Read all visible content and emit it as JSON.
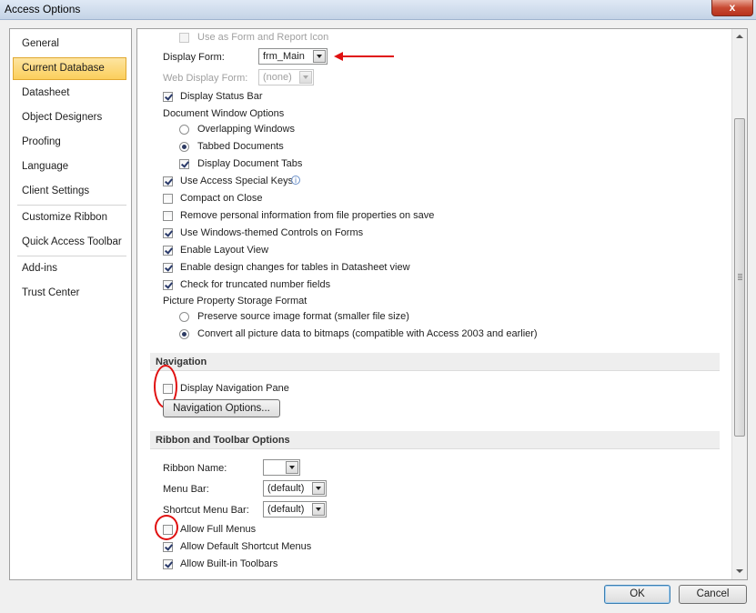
{
  "window": {
    "title": "Access Options",
    "close_label": "x"
  },
  "sidebar": {
    "items": [
      {
        "label": "General"
      },
      {
        "label": "Current Database"
      },
      {
        "label": "Datasheet"
      },
      {
        "label": "Object Designers"
      },
      {
        "label": "Proofing"
      },
      {
        "label": "Language"
      },
      {
        "label": "Client Settings"
      },
      {
        "label": "Customize Ribbon"
      },
      {
        "label": "Quick Access Toolbar"
      },
      {
        "label": "Add-ins"
      },
      {
        "label": "Trust Center"
      }
    ],
    "selected": "Current Database"
  },
  "app_options": {
    "use_as_form_report_icon": {
      "label": "Use as Form and Report Icon",
      "checked": false,
      "enabled": false
    },
    "display_form": {
      "label": "Display Form:",
      "value": "frm_Main"
    },
    "web_display_form": {
      "label": "Web Display Form:",
      "value": "(none)",
      "enabled": false
    },
    "display_status_bar": {
      "label": "Display Status Bar",
      "checked": true
    },
    "document_window_options": {
      "label": "Document Window Options",
      "overlapping_windows": {
        "label": "Overlapping Windows",
        "selected": false
      },
      "tabbed_documents": {
        "label": "Tabbed Documents",
        "selected": true
      },
      "display_document_tabs": {
        "label": "Display Document Tabs",
        "checked": true
      }
    },
    "use_access_special_keys": {
      "label": "Use Access Special Keys",
      "checked": true,
      "info_icon": "info-icon"
    },
    "compact_on_close": {
      "label": "Compact on Close",
      "checked": false
    },
    "remove_personal_info": {
      "label": "Remove personal information from file properties on save",
      "checked": false
    },
    "use_windows_themed_controls": {
      "label": "Use Windows-themed Controls on Forms",
      "checked": true
    },
    "enable_layout_view": {
      "label": "Enable Layout View",
      "checked": true
    },
    "enable_design_changes": {
      "label": "Enable design changes for tables in Datasheet view",
      "checked": true
    },
    "check_truncated_numbers": {
      "label": "Check for truncated number fields",
      "checked": true
    },
    "picture_property_storage": {
      "label": "Picture Property Storage Format",
      "preserve_source": {
        "label": "Preserve source image format (smaller file size)",
        "selected": false
      },
      "convert_to_bitmaps": {
        "label": "Convert all picture data to bitmaps (compatible with Access 2003 and earlier)",
        "selected": true
      }
    }
  },
  "navigation": {
    "header": "Navigation",
    "display_navigation_pane": {
      "label": "Display Navigation Pane",
      "checked": false
    },
    "navigation_options_button": "Navigation Options..."
  },
  "ribbon_toolbar": {
    "header": "Ribbon and Toolbar Options",
    "ribbon_name": {
      "label": "Ribbon Name:",
      "value": ""
    },
    "menu_bar": {
      "label": "Menu Bar:",
      "value": "(default)"
    },
    "shortcut_menu_bar": {
      "label": "Shortcut Menu Bar:",
      "value": "(default)"
    },
    "allow_full_menus": {
      "label": "Allow Full Menus",
      "checked": false
    },
    "allow_default_shortcut_menus": {
      "label": "Allow Default Shortcut Menus",
      "checked": true
    },
    "allow_builtin_toolbars": {
      "label": "Allow Built-in Toolbars",
      "checked": true
    }
  },
  "footer": {
    "ok_label": "OK",
    "cancel_label": "Cancel"
  },
  "colors": {
    "annotation": "#e01010",
    "selection_gold": "#fbcf5c",
    "window_bg": "#f0f0f0"
  }
}
